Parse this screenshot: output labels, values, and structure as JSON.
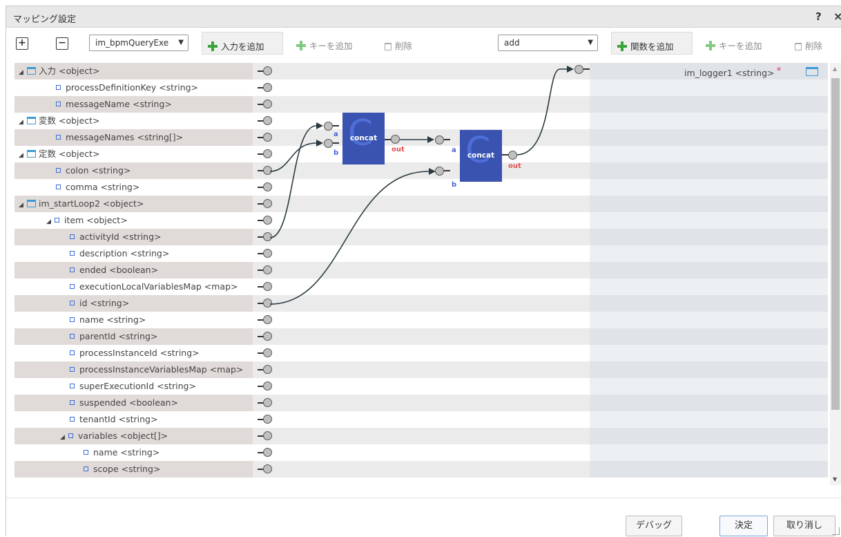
{
  "window": {
    "title": "マッピング設定",
    "help_label": "?",
    "close_label": "×"
  },
  "toolbar": {
    "expand_label": "+",
    "collapse_label": "−",
    "input_select_value": "im_bpmQueryExe",
    "add_input_label": "入力を追加",
    "add_key_label": "キーを追加",
    "delete_label": "削除",
    "function_select_value": "add",
    "add_function_label": "関数を追加",
    "add_key_right_label": "キーを追加",
    "delete_right_label": "削除"
  },
  "left_tree": [
    {
      "label": "入力 <object>",
      "depth": 0,
      "type": "object",
      "expanded": true
    },
    {
      "label": "processDefinitionKey <string>",
      "depth": 1,
      "type": "leaf"
    },
    {
      "label": "messageName <string>",
      "depth": 1,
      "type": "leaf"
    },
    {
      "label": "変数 <object>",
      "depth": 0,
      "type": "object",
      "expanded": true
    },
    {
      "label": "messageNames <string[]>",
      "depth": 1,
      "type": "leaf"
    },
    {
      "label": "定数 <object>",
      "depth": 0,
      "type": "object",
      "expanded": true
    },
    {
      "label": "colon <string>",
      "depth": 1,
      "type": "leaf"
    },
    {
      "label": "comma <string>",
      "depth": 1,
      "type": "leaf"
    },
    {
      "label": "im_startLoop2 <object>",
      "depth": 0,
      "type": "object",
      "expanded": true
    },
    {
      "label": "item <object>",
      "depth": 1,
      "type": "leaf",
      "expanded": true
    },
    {
      "label": "activityId <string>",
      "depth": 2,
      "type": "leaf"
    },
    {
      "label": "description <string>",
      "depth": 2,
      "type": "leaf"
    },
    {
      "label": "ended <boolean>",
      "depth": 2,
      "type": "leaf"
    },
    {
      "label": "executionLocalVariablesMap <map>",
      "depth": 2,
      "type": "leaf"
    },
    {
      "label": "id <string>",
      "depth": 2,
      "type": "leaf"
    },
    {
      "label": "name <string>",
      "depth": 2,
      "type": "leaf"
    },
    {
      "label": "parentId <string>",
      "depth": 2,
      "type": "leaf"
    },
    {
      "label": "processInstanceId <string>",
      "depth": 2,
      "type": "leaf"
    },
    {
      "label": "processInstanceVariablesMap <map>",
      "depth": 2,
      "type": "leaf"
    },
    {
      "label": "superExecutionId <string>",
      "depth": 2,
      "type": "leaf"
    },
    {
      "label": "suspended <boolean>",
      "depth": 2,
      "type": "leaf"
    },
    {
      "label": "tenantId <string>",
      "depth": 2,
      "type": "leaf"
    },
    {
      "label": "variables <object[]>",
      "depth": 2,
      "type": "leaf",
      "expanded": true
    },
    {
      "label": "name <string>",
      "depth": 3,
      "type": "leaf"
    },
    {
      "label": "scope <string>",
      "depth": 3,
      "type": "leaf"
    }
  ],
  "right_tree": [
    {
      "label": "im_logger1 <string>",
      "required_mark": "*"
    }
  ],
  "functions": [
    {
      "name": "concat",
      "letter": "C",
      "inputs": [
        "a",
        "b"
      ],
      "output": "out"
    },
    {
      "name": "concat",
      "letter": "C",
      "inputs": [
        "a",
        "b"
      ],
      "output": "out"
    }
  ],
  "footer": {
    "debug_label": "デバッグ",
    "ok_label": "決定",
    "cancel_label": "取り消し"
  },
  "colors": {
    "function_block": "#3a52b0",
    "object_icon": "#3b9ad6",
    "input_port_label": "#4a62d6",
    "output_port_label": "#e05050",
    "add_icon": "#3aa33a"
  }
}
